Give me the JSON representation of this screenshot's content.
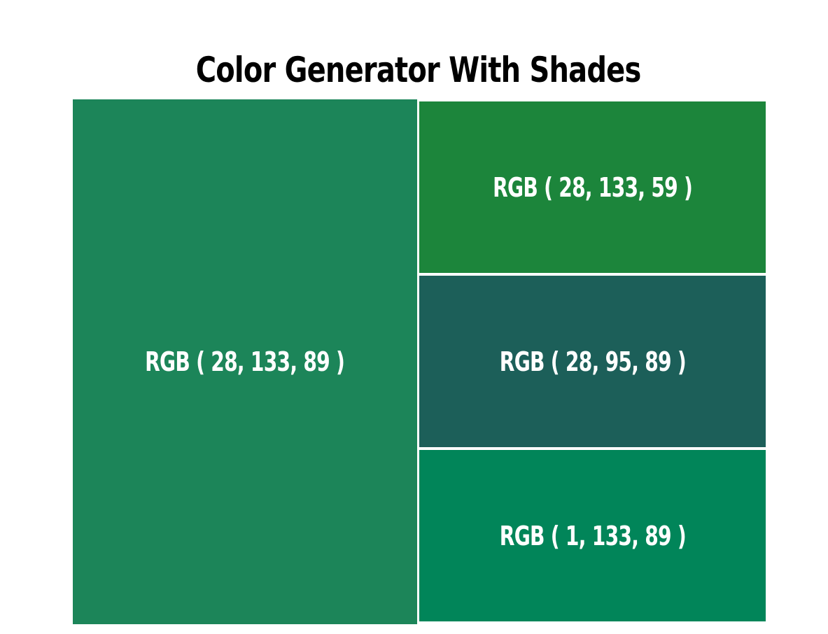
{
  "title": "Color Generator With Shades",
  "swatches": {
    "main": {
      "label": "RGB ( 28, 133, 89 )",
      "color": "#1c8559"
    },
    "top": {
      "label": "RGB ( 28, 133, 59 )",
      "color": "#1c853b"
    },
    "middle": {
      "label": "RGB ( 28, 95, 89 )",
      "color": "#1c5f59"
    },
    "bottom": {
      "label": "RGB ( 1, 133, 89 )",
      "color": "#018559"
    }
  }
}
